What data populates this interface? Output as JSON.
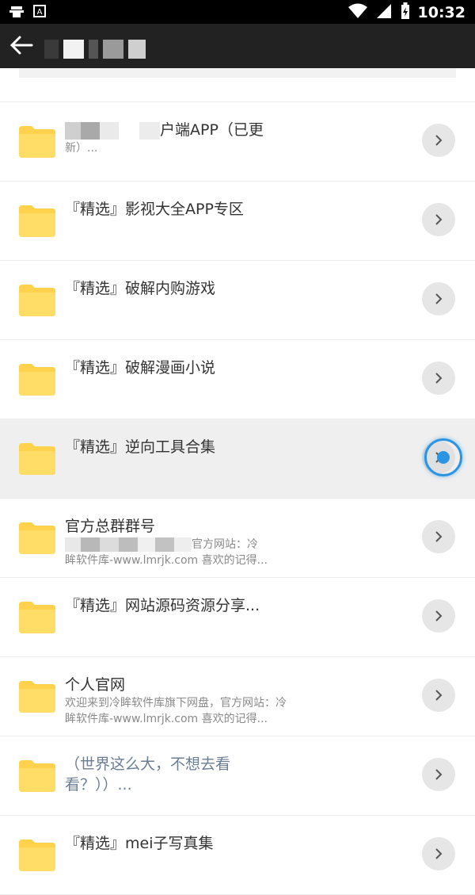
{
  "status": {
    "time": "10:32",
    "icons": [
      "bug-icon",
      "a-badge-icon",
      "wifi-icon",
      "signal-icon",
      "battery-charging-icon"
    ]
  },
  "appbar": {
    "back_icon": "arrow-left-icon"
  },
  "colors": {
    "appbar": "#222222",
    "folder": "#FFD24D",
    "accent_ring": "#2B95E3",
    "highlight_row": "#EFEFEF"
  },
  "items": [
    {
      "name": "户端APP（已更",
      "sub": "新）..."
    },
    {
      "name": "『精选』影视大全APP专区",
      "sub": ""
    },
    {
      "name": "『精选』破解内购游戏",
      "sub": ""
    },
    {
      "name": "『精选』破解漫画小说",
      "sub": ""
    },
    {
      "name": "『精选』逆向工具合集",
      "sub": ""
    },
    {
      "name": "官方总群群号",
      "sub1": "官方网站：冷",
      "sub2": "眸软件库-www.lmrjk.com 喜欢的记得..."
    },
    {
      "name": "『精选』网站源码资源分享...",
      "sub": ""
    },
    {
      "name": "个人官网",
      "sub1": "欢迎来到冷眸软件库旗下网盘，官方网站：冷",
      "sub2": "眸软件库-www.lmrjk.com 喜欢的记得..."
    },
    {
      "name": "（世界这么大，不想去看",
      "name2": "看？））..."
    },
    {
      "name": "『精选』mei子写真集",
      "sub": ""
    }
  ]
}
